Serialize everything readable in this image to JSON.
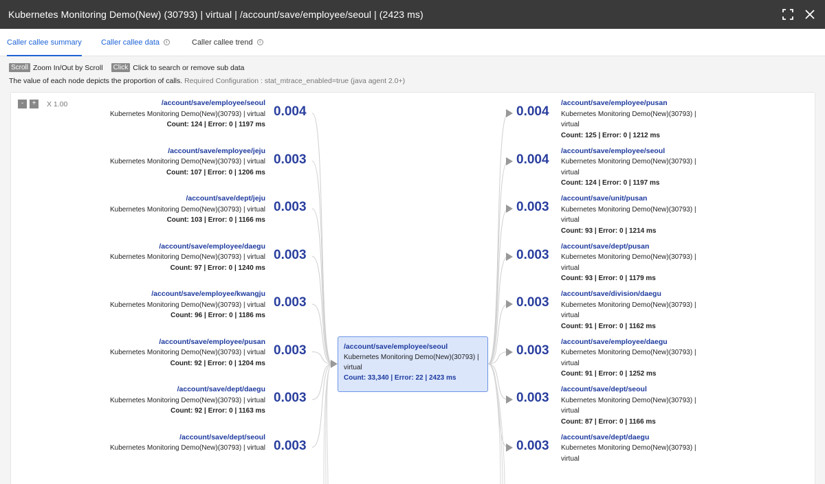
{
  "window": {
    "title": "Kubernetes Monitoring Demo(New) (30793) | virtual | /account/save/employee/seoul | (2423 ms)"
  },
  "tabs": [
    {
      "label": "Caller callee summary"
    },
    {
      "label": "Caller callee data"
    },
    {
      "label": "Caller callee trend"
    }
  ],
  "hint": {
    "scroll_key": "Scroll",
    "scroll_text": "Zoom In/Out by Scroll",
    "click_key": "Click",
    "click_text": "Click to search or remove sub data"
  },
  "description": {
    "text": "The value of each node depicts the proportion of calls.",
    "requirement": "Required Configuration : stat_mtrace_enabled=true (java agent 2.0+)"
  },
  "zoom": {
    "minus": "-",
    "plus": "+",
    "level": "X 1.00"
  },
  "center": {
    "path": "/account/save/employee/seoul",
    "app": "Kubernetes Monitoring Demo(New)(30793) | virtual",
    "stats": "Count: 33,340 | Error: 22 | 2423 ms"
  },
  "callers": [
    {
      "path": "/account/save/employee/seoul",
      "app": "Kubernetes Monitoring Demo(New)(30793) | virtual",
      "stats": "Count: 124 | Error: 0 | 1197 ms",
      "ratio": "0.004"
    },
    {
      "path": "/account/save/employee/jeju",
      "app": "Kubernetes Monitoring Demo(New)(30793) | virtual",
      "stats": "Count: 107 | Error: 0 | 1206 ms",
      "ratio": "0.003"
    },
    {
      "path": "/account/save/dept/jeju",
      "app": "Kubernetes Monitoring Demo(New)(30793) | virtual",
      "stats": "Count: 103 | Error: 0 | 1166 ms",
      "ratio": "0.003"
    },
    {
      "path": "/account/save/employee/daegu",
      "app": "Kubernetes Monitoring Demo(New)(30793) | virtual",
      "stats": "Count: 97 | Error: 0 | 1240 ms",
      "ratio": "0.003"
    },
    {
      "path": "/account/save/employee/kwangju",
      "app": "Kubernetes Monitoring Demo(New)(30793) | virtual",
      "stats": "Count: 96 | Error: 0 | 1186 ms",
      "ratio": "0.003"
    },
    {
      "path": "/account/save/employee/pusan",
      "app": "Kubernetes Monitoring Demo(New)(30793) | virtual",
      "stats": "Count: 92 | Error: 0 | 1204 ms",
      "ratio": "0.003"
    },
    {
      "path": "/account/save/dept/daegu",
      "app": "Kubernetes Monitoring Demo(New)(30793) | virtual",
      "stats": "Count: 92 | Error: 0 | 1163 ms",
      "ratio": "0.003"
    },
    {
      "path": "/account/save/dept/seoul",
      "app": "Kubernetes Monitoring Demo(New)(30793) | virtual",
      "stats": "",
      "ratio": "0.003"
    }
  ],
  "callees": [
    {
      "path": "/account/save/employee/pusan",
      "app": "Kubernetes Monitoring Demo(New)(30793) | virtual",
      "stats": "Count: 125 | Error: 0 | 1212 ms",
      "ratio": "0.004"
    },
    {
      "path": "/account/save/employee/seoul",
      "app": "Kubernetes Monitoring Demo(New)(30793) | virtual",
      "stats": "Count: 124 | Error: 0 | 1197 ms",
      "ratio": "0.004"
    },
    {
      "path": "/account/save/unit/pusan",
      "app": "Kubernetes Monitoring Demo(New)(30793) | virtual",
      "stats": "Count: 93 | Error: 0 | 1214 ms",
      "ratio": "0.003"
    },
    {
      "path": "/account/save/dept/pusan",
      "app": "Kubernetes Monitoring Demo(New)(30793) | virtual",
      "stats": "Count: 93 | Error: 0 | 1179 ms",
      "ratio": "0.003"
    },
    {
      "path": "/account/save/division/daegu",
      "app": "Kubernetes Monitoring Demo(New)(30793) | virtual",
      "stats": "Count: 91 | Error: 0 | 1162 ms",
      "ratio": "0.003"
    },
    {
      "path": "/account/save/employee/daegu",
      "app": "Kubernetes Monitoring Demo(New)(30793) | virtual",
      "stats": "Count: 91 | Error: 0 | 1252 ms",
      "ratio": "0.003"
    },
    {
      "path": "/account/save/dept/seoul",
      "app": "Kubernetes Monitoring Demo(New)(30793) | virtual",
      "stats": "Count: 87 | Error: 0 | 1166 ms",
      "ratio": "0.003"
    },
    {
      "path": "/account/save/dept/daegu",
      "app": "Kubernetes Monitoring Demo(New)(30793) | virtual",
      "stats": "",
      "ratio": "0.003"
    }
  ]
}
